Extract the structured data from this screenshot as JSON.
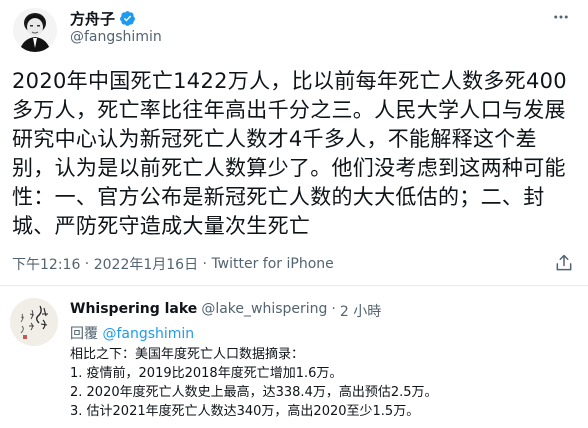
{
  "main_tweet": {
    "author_name": "方舟子",
    "author_handle": "@fangshimin",
    "verified_icon": "verified-badge-icon",
    "text": "2020年中国死亡1422万人，比以前每年死亡人数多死400多万人，死亡率比往年高出千分之三。人民大学人口与发展研究中心认为新冠死亡人数才4千多人，不能解释这个差别，认为是以前死亡人数算少了。他们没考虑到这两种可能性：一、官方公布是新冠死亡人数的大大低估的；二、封城、严防死守造成大量次生死亡",
    "time": "下午12:16",
    "date": "2022年1月16日",
    "separator": " · ",
    "source": "Twitter for iPhone"
  },
  "reply": {
    "author_name": "Whispering lake",
    "author_handle": "@lake_whispering",
    "separator": "·",
    "time_ago": "2 小時",
    "reply_label": "回覆",
    "reply_mention": "@fangshimin",
    "lines": [
      "相比之下：美国年度死亡人口数据摘录：",
      "1. 疫情前，2019比2018年度死亡增加1.6万。",
      "2. 2020年度死亡人数史上最高，达338.4万，高出预估2.5万。",
      "3. 估计2021年度死亡人数达340万，高出2020至少1.5万。"
    ]
  },
  "colors": {
    "text": "#0f1419",
    "secondary": "#536471",
    "link": "#1d9bf0",
    "verified": "#1d9bf0",
    "divider": "#e6ecf0"
  }
}
